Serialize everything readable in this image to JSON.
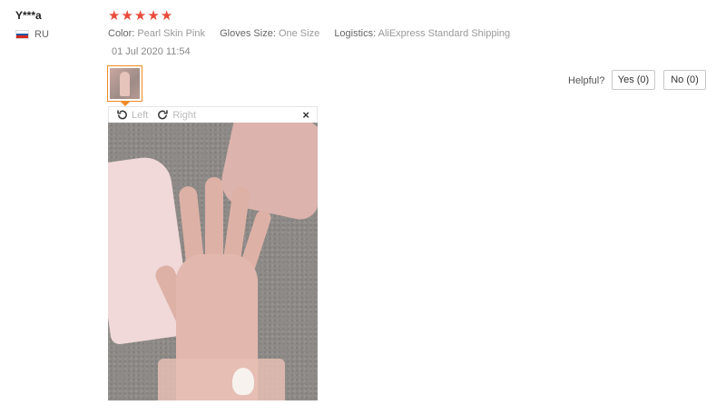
{
  "review": {
    "user": "Y***a",
    "country": "RU",
    "rating": 5,
    "attributes": {
      "color_key": "Color:",
      "color_val": "Pearl Skin Pink",
      "size_key": "Gloves Size:",
      "size_val": "One Size",
      "logistics_key": "Logistics:",
      "logistics_val": "AliExpress Standard Shipping"
    },
    "date": "01 Jul 2020 11:54",
    "helpful_label": "Helpful?",
    "yes_label": "Yes (0)",
    "no_label": "No (0)"
  },
  "viewer": {
    "rotate_left": "Left",
    "rotate_right": "Right",
    "close": "×"
  },
  "colors": {
    "star": "#e84a3c",
    "thumb_border": "#f08a24"
  },
  "icons": {
    "rotate_left": "rotate-left-icon",
    "rotate_right": "rotate-right-icon",
    "close": "close-icon",
    "flag": "russia-flag-icon",
    "star": "star-icon"
  }
}
